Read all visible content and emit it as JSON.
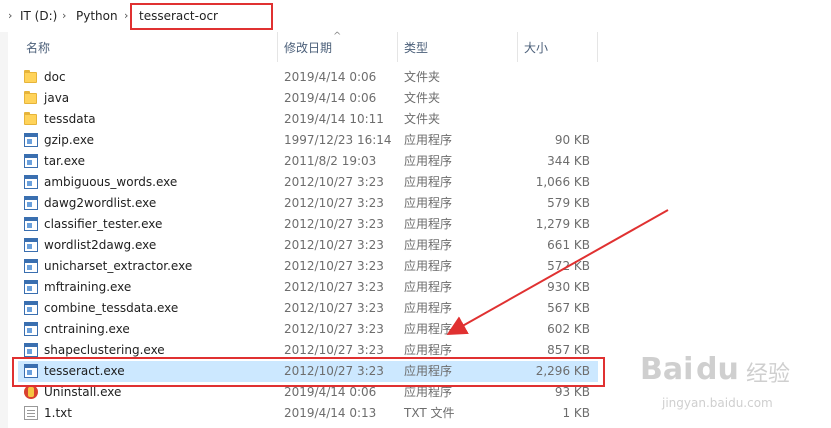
{
  "breadcrumb": {
    "items": [
      "IT (D:)",
      "Python",
      "tesseract-ocr"
    ],
    "separators": [
      "›",
      "›",
      "›"
    ]
  },
  "columns": {
    "name": "名称",
    "date": "修改日期",
    "type": "类型",
    "size": "大小"
  },
  "files": [
    {
      "name": "doc",
      "date": "2019/4/14 0:06",
      "type": "文件夹",
      "size": "",
      "icon": "folder-icon"
    },
    {
      "name": "java",
      "date": "2019/4/14 0:06",
      "type": "文件夹",
      "size": "",
      "icon": "folder-icon"
    },
    {
      "name": "tessdata",
      "date": "2019/4/14 10:11",
      "type": "文件夹",
      "size": "",
      "icon": "folder-icon"
    },
    {
      "name": "gzip.exe",
      "date": "1997/12/23 16:14",
      "type": "应用程序",
      "size": "90 KB",
      "icon": "exe-icon"
    },
    {
      "name": "tar.exe",
      "date": "2011/8/2 19:03",
      "type": "应用程序",
      "size": "344 KB",
      "icon": "exe-icon"
    },
    {
      "name": "ambiguous_words.exe",
      "date": "2012/10/27 3:23",
      "type": "应用程序",
      "size": "1,066 KB",
      "icon": "exe-icon"
    },
    {
      "name": "dawg2wordlist.exe",
      "date": "2012/10/27 3:23",
      "type": "应用程序",
      "size": "579 KB",
      "icon": "exe-icon"
    },
    {
      "name": "classifier_tester.exe",
      "date": "2012/10/27 3:23",
      "type": "应用程序",
      "size": "1,279 KB",
      "icon": "exe-icon"
    },
    {
      "name": "wordlist2dawg.exe",
      "date": "2012/10/27 3:23",
      "type": "应用程序",
      "size": "661 KB",
      "icon": "exe-icon"
    },
    {
      "name": "unicharset_extractor.exe",
      "date": "2012/10/27 3:23",
      "type": "应用程序",
      "size": "572 KB",
      "icon": "exe-icon"
    },
    {
      "name": "mftraining.exe",
      "date": "2012/10/27 3:23",
      "type": "应用程序",
      "size": "930 KB",
      "icon": "exe-icon"
    },
    {
      "name": "combine_tessdata.exe",
      "date": "2012/10/27 3:23",
      "type": "应用程序",
      "size": "567 KB",
      "icon": "exe-icon"
    },
    {
      "name": "cntraining.exe",
      "date": "2012/10/27 3:23",
      "type": "应用程序",
      "size": "602 KB",
      "icon": "exe-icon"
    },
    {
      "name": "shapeclustering.exe",
      "date": "2012/10/27 3:23",
      "type": "应用程序",
      "size": "857 KB",
      "icon": "exe-icon"
    },
    {
      "name": "tesseract.exe",
      "date": "2012/10/27 3:23",
      "type": "应用程序",
      "size": "2,296 KB",
      "icon": "exe-icon",
      "selected": true
    },
    {
      "name": "Uninstall.exe",
      "date": "2019/4/14 0:06",
      "type": "应用程序",
      "size": "93 KB",
      "icon": "uninstall-icon"
    },
    {
      "name": "1.txt",
      "date": "2019/4/14 0:13",
      "type": "TXT 文件",
      "size": "1 KB",
      "icon": "txt-icon"
    }
  ],
  "watermark": {
    "brand": "Bai",
    "brand2": "du",
    "suffix": "经验",
    "url": "jingyan.baidu.com"
  },
  "colors": {
    "highlight": "#e03131",
    "selection": "#cce8ff"
  }
}
